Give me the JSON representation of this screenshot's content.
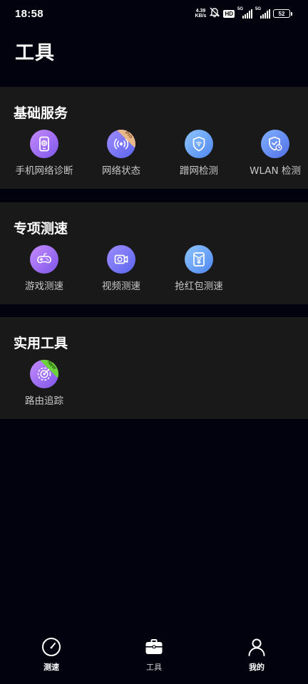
{
  "status_bar": {
    "time": "18:58",
    "net_speed_value": "4.39",
    "net_speed_unit": "KB/s",
    "hd_badge": "HD",
    "sim1_label": "5G",
    "sim2_label": "5G",
    "battery": "52"
  },
  "page": {
    "title": "工具"
  },
  "sections": [
    {
      "title": "基础服务",
      "items": [
        {
          "label": "手机网络诊断",
          "icon": "phone-diagnose-icon",
          "badge": ""
        },
        {
          "label": "网络状态",
          "icon": "wireless-signal-icon",
          "badge": "Pro"
        },
        {
          "label": "蹭网检测",
          "icon": "shield-wifi-icon",
          "badge": ""
        },
        {
          "label": "WLAN 检测",
          "icon": "shield-check-icon",
          "badge": ""
        }
      ]
    },
    {
      "title": "专项测速",
      "items": [
        {
          "label": "游戏测速",
          "icon": "gamepad-icon",
          "badge": ""
        },
        {
          "label": "视频测速",
          "icon": "video-camera-icon",
          "badge": ""
        },
        {
          "label": "抢红包测速",
          "icon": "red-envelope-icon",
          "badge": ""
        }
      ]
    },
    {
      "title": "实用工具",
      "items": [
        {
          "label": "路由追踪",
          "icon": "route-trace-icon",
          "badge": "New"
        }
      ]
    }
  ],
  "bottom_nav": [
    {
      "label": "测速",
      "icon": "speedometer-icon"
    },
    {
      "label": "工具",
      "icon": "toolbox-icon"
    },
    {
      "label": "我的",
      "icon": "user-icon"
    }
  ]
}
